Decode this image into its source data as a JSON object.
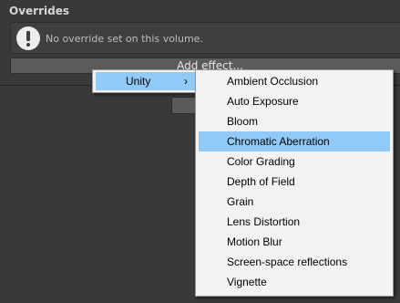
{
  "inspector": {
    "overrides_title": "Overrides",
    "info_message": "No override set on this volume.",
    "add_effect_label": "Add effect..."
  },
  "context_menu": {
    "parent": {
      "label": "Unity",
      "submenu_glyph": "›"
    },
    "items": [
      {
        "label": "Ambient Occlusion",
        "highlighted": false
      },
      {
        "label": "Auto Exposure",
        "highlighted": false
      },
      {
        "label": "Bloom",
        "highlighted": false
      },
      {
        "label": "Chromatic Aberration",
        "highlighted": true
      },
      {
        "label": "Color Grading",
        "highlighted": false
      },
      {
        "label": "Depth of Field",
        "highlighted": false
      },
      {
        "label": "Grain",
        "highlighted": false
      },
      {
        "label": "Lens Distortion",
        "highlighted": false
      },
      {
        "label": "Motion Blur",
        "highlighted": false
      },
      {
        "label": "Screen-space reflections",
        "highlighted": false
      },
      {
        "label": "Vignette",
        "highlighted": false
      }
    ]
  },
  "colors": {
    "panel_bg": "#393939",
    "menu_bg": "#f2f2f2",
    "menu_highlight": "#91c9f7",
    "info_icon": "#ededed"
  },
  "icons": {
    "info": "info-icon",
    "submenu": "chevron-right-icon"
  }
}
